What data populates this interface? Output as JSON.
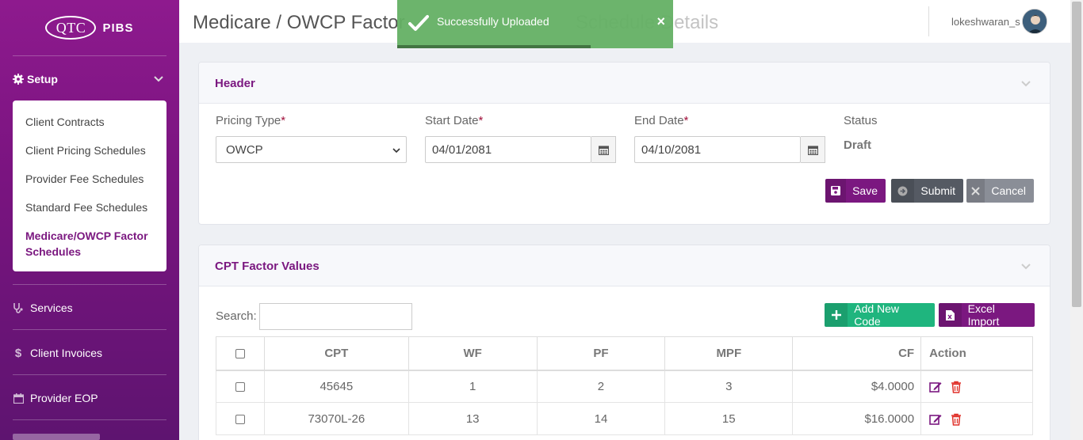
{
  "brand": {
    "logo_mark": "QTC",
    "name": "PIBS"
  },
  "sidebar": {
    "setup_label": "Setup",
    "setup_items": [
      {
        "label": "Client Contracts"
      },
      {
        "label": "Client Pricing Schedules"
      },
      {
        "label": "Provider Fee Schedules"
      },
      {
        "label": "Standard Fee Schedules"
      },
      {
        "label": "Medicare/OWCP Factor Schedules",
        "active": true
      }
    ],
    "nav": [
      {
        "label": "Services",
        "icon": "stethoscope-icon"
      },
      {
        "label": "Client Invoices",
        "icon": "dollar-icon"
      },
      {
        "label": "Provider EOP",
        "icon": "calendar-icon"
      }
    ]
  },
  "topbar": {
    "page_title": "Medicare / OWCP Factor",
    "page_title_hidden": "Schedule Details",
    "username": "lokeshwaran_s"
  },
  "toast": {
    "message": "Successfully Uploaded",
    "close_glyph": "×",
    "progress": 0.7,
    "color": "#64b064"
  },
  "header_card": {
    "title": "Header",
    "pricing_type": {
      "label": "Pricing Type",
      "required": "*",
      "value": "OWCP"
    },
    "start_date": {
      "label": "Start Date",
      "required": "*",
      "value": "04/01/2081"
    },
    "end_date": {
      "label": "End Date",
      "required": "*",
      "value": "04/10/2081"
    },
    "status": {
      "label": "Status",
      "value": "Draft"
    },
    "buttons": {
      "save": "Save",
      "submit": "Submit",
      "cancel": "Cancel"
    }
  },
  "cpt_card": {
    "title": "CPT Factor Values",
    "search_label": "Search:",
    "search_value": "",
    "add_button": "Add New Code",
    "excel_button": "Excel Import",
    "columns": [
      "CPT",
      "WF",
      "PF",
      "MPF",
      "CF",
      "Action"
    ],
    "rows": [
      {
        "cpt": "45645",
        "wf": "1",
        "pf": "2",
        "mpf": "3",
        "cf": "$4.0000"
      },
      {
        "cpt": "73070L-26",
        "wf": "13",
        "pf": "14",
        "mpf": "15",
        "cf": "$16.0000"
      }
    ]
  },
  "colors": {
    "brand_purple": "#7b1880",
    "add_green": "#1fb57e"
  }
}
